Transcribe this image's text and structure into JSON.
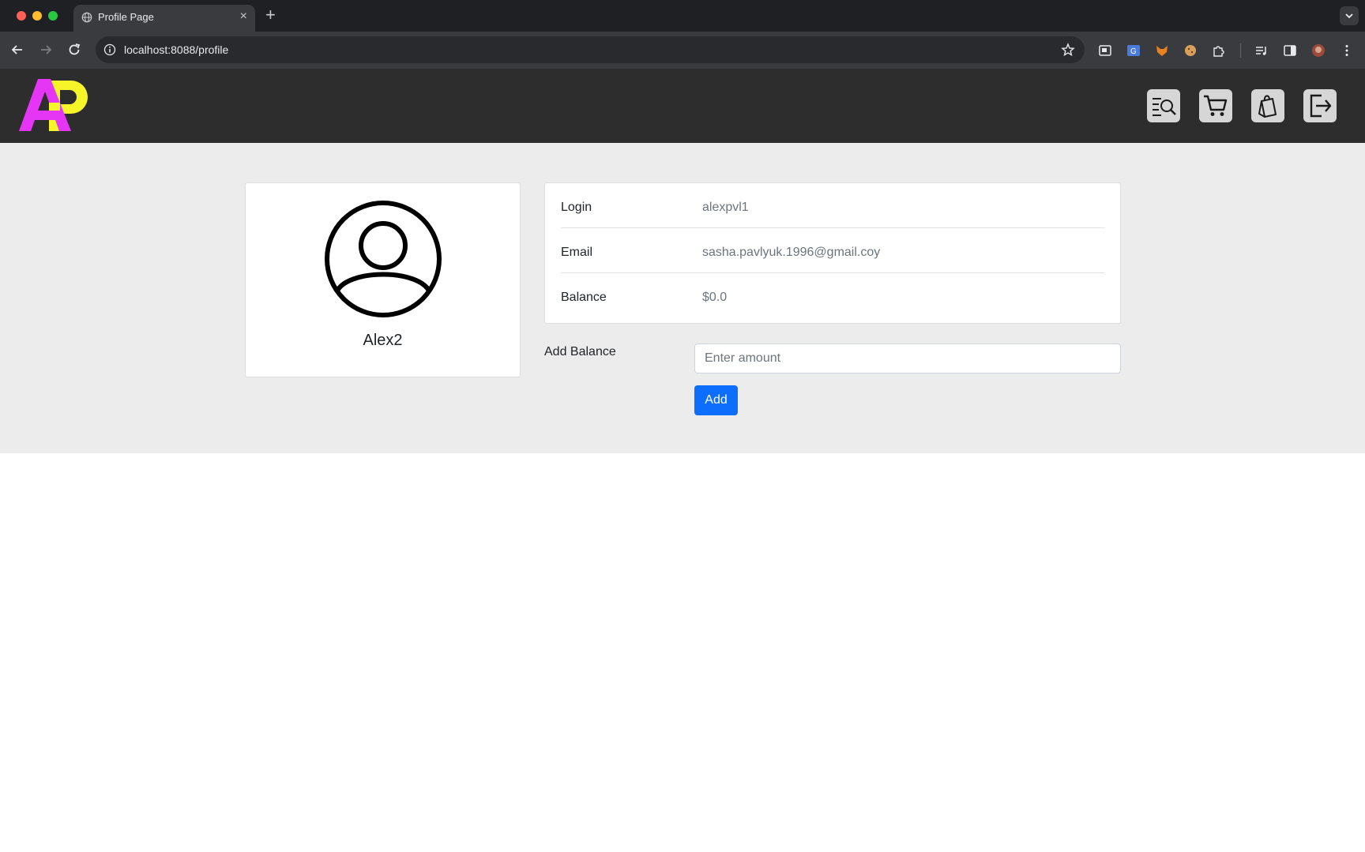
{
  "browser": {
    "tab_title": "Profile Page",
    "tab_close": "×",
    "new_tab": "+",
    "url": "localhost:8088/profile"
  },
  "header": {
    "logo_text": "AP",
    "buttons": [
      {
        "icon": "catalog-search-icon"
      },
      {
        "icon": "cart-icon"
      },
      {
        "icon": "shopping-bag-icon"
      },
      {
        "icon": "logout-icon"
      }
    ]
  },
  "profile": {
    "username": "Alex2",
    "avatar_icon": "user-circle-icon"
  },
  "info": {
    "rows": [
      {
        "label": "Login",
        "value": "alexpvl1"
      },
      {
        "label": "Email",
        "value": "sasha.pavlyuk.1996@gmail.coy"
      },
      {
        "label": "Balance",
        "value": "$0.0"
      }
    ]
  },
  "add_balance": {
    "label": "Add Balance",
    "placeholder": "Enter amount",
    "button_label": "Add"
  },
  "colors": {
    "header_bg": "#2d2d2d",
    "content_bg": "#ececec",
    "primary": "#0d6efd",
    "logo_magenta": "#e636f5",
    "logo_yellow": "#f5f52a"
  }
}
